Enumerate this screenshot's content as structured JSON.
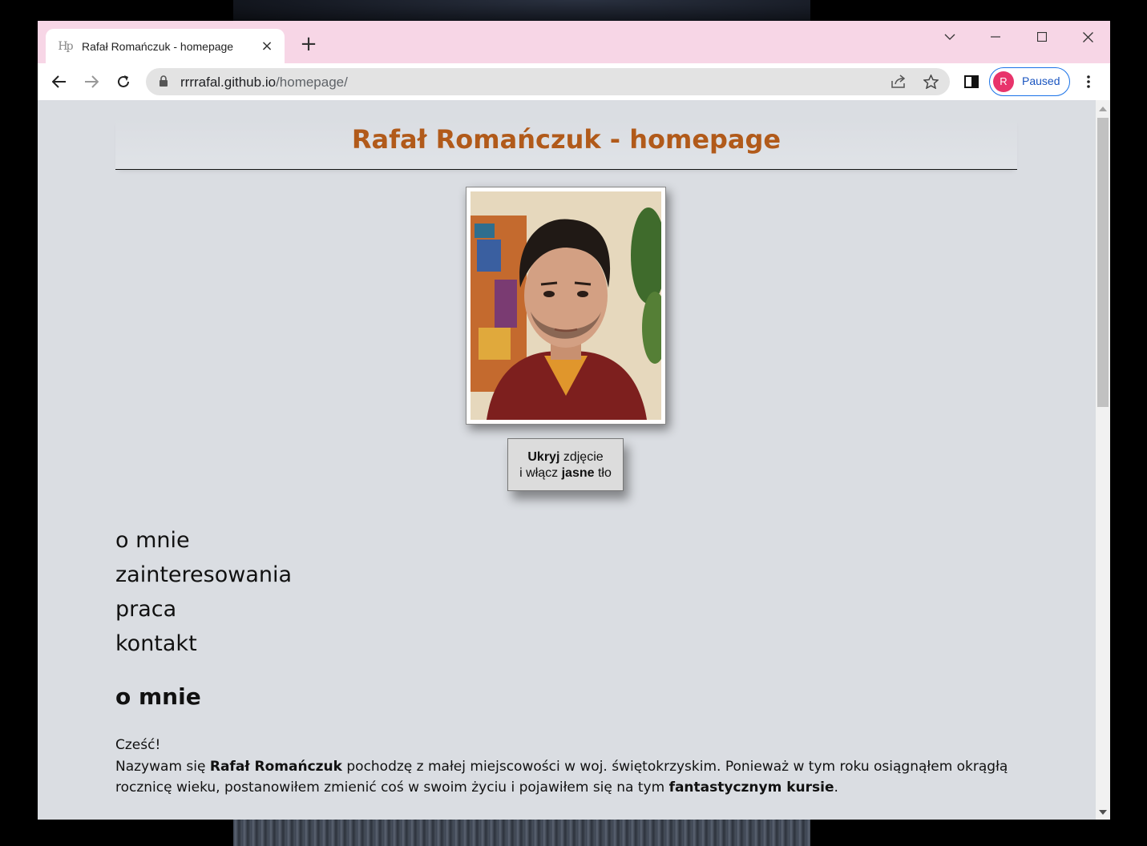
{
  "browser": {
    "tab": {
      "favicon_text": "Hp",
      "title": "Rafał Romańczuk - homepage",
      "close": "×"
    },
    "new_tab": "+",
    "url_host": "rrrrafal.github.io",
    "url_path": "/homepage/",
    "profile": {
      "initial": "R",
      "status": "Paused"
    }
  },
  "page": {
    "title": "Rafał Romańczuk - homepage",
    "toggle_button": {
      "line1_bold": "Ukryj",
      "line1_rest": " zdjęcie",
      "line2_pre": "i włącz ",
      "line2_bold": "jasne",
      "line2_post": " tło"
    },
    "menu": [
      "o mnie",
      "zainteresowania",
      "praca",
      "kontakt"
    ],
    "section_title": "o mnie",
    "greeting": "Cześć!",
    "intro_pre": "Nazywam się ",
    "intro_name": "Rafał Romańczuk",
    "intro_mid": " pochodzę z małej miejscowości w woj. świętokrzyskim. Ponieważ w tym roku osiągnąłem okrągłą rocznicę wieku, postanowiłem zmienić coś w swoim życiu i pojawiłem się na tym ",
    "intro_course": "fantastycznym kursie",
    "intro_end": "."
  },
  "colors": {
    "title": "#b15a1a",
    "titlebar": "#f7d6e6",
    "page_bg": "#dadde2",
    "avatar": "#e8346b"
  }
}
